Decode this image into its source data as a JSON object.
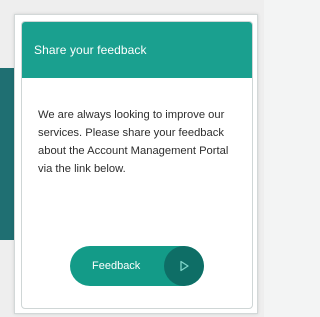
{
  "card": {
    "title": "Share your feedback",
    "body": "We are always looking to improve our services. Please share your feedback about the Account Management Portal via the link below.",
    "button_label": "Feedback",
    "button_icon": "play-icon"
  },
  "colors": {
    "header": "#1aa08f",
    "button": "#139b88",
    "button_icon_bg": "#0e6e66",
    "background_panel": "#1f6f72"
  }
}
